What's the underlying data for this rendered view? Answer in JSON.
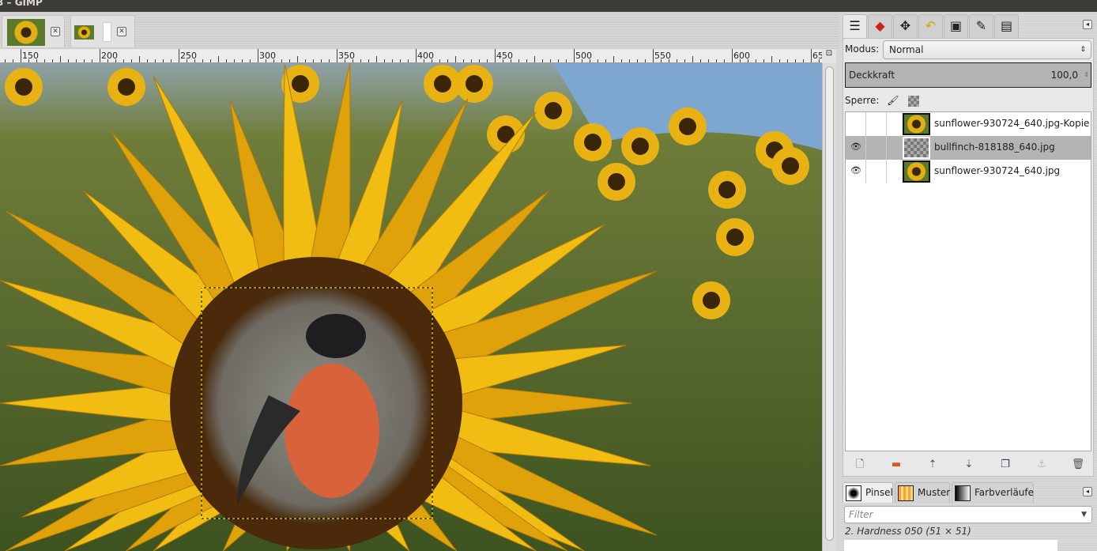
{
  "window": {
    "title": "3 – GIMP"
  },
  "image_tabs": [
    {
      "name": "sunflower image"
    },
    {
      "name": "composition image"
    }
  ],
  "ruler": {
    "labels": [
      "150",
      "200",
      "250",
      "300",
      "350",
      "400",
      "450",
      "500",
      "550",
      "600",
      "65"
    ]
  },
  "dock": {
    "tabs": [
      "layers",
      "channels",
      "paths",
      "undo-history",
      "images",
      "tool-options",
      "gradients"
    ],
    "mode_label": "Modus:",
    "mode_value": "Normal",
    "opacity_label": "Deckkraft",
    "opacity_value": "100,0",
    "lock_label": "Sperre:",
    "layers": [
      {
        "name": "sunflower-930724_640.jpg-Kopie",
        "visible": false,
        "selected": false
      },
      {
        "name": "bullfinch-818188_640.jpg",
        "visible": true,
        "selected": true
      },
      {
        "name": "sunflower-930724_640.jpg",
        "visible": true,
        "selected": false
      }
    ]
  },
  "brush_dock": {
    "tabs": [
      "Pinsel",
      "Muster",
      "Farbverläufe"
    ],
    "filter_placeholder": "Filter",
    "brush_info": "2. Hardness 050 (51 × 51)"
  }
}
